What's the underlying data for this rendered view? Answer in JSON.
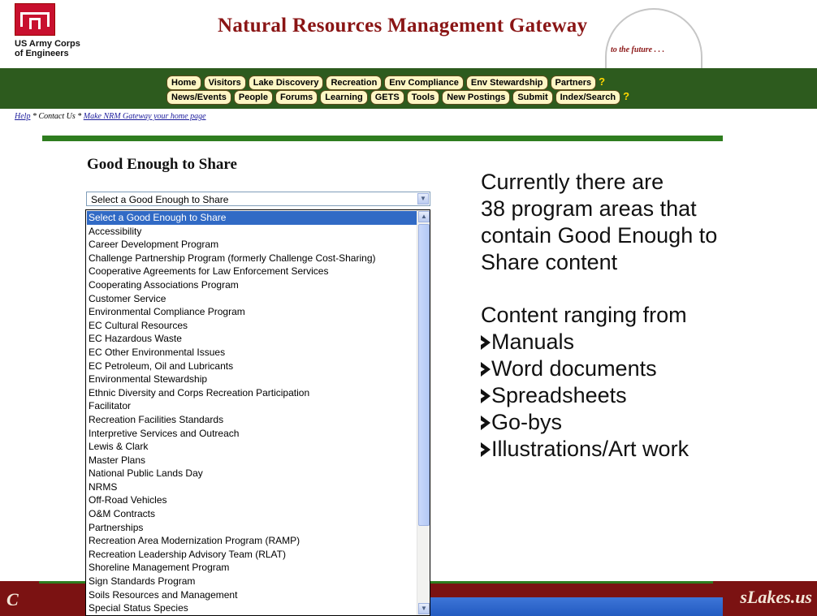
{
  "header": {
    "org_line1": "US Army Corps",
    "org_line2": "of Engineers",
    "title": "Natural Resources Management Gateway",
    "tagline": "to the future . . ."
  },
  "nav": {
    "row1": [
      "Home",
      "Visitors",
      "Lake Discovery",
      "Recreation",
      "Env Compliance",
      "Env Stewardship",
      "Partners"
    ],
    "row2": [
      "News/Events",
      "People",
      "Forums",
      "Learning",
      "GETS",
      "Tools",
      "New Postings",
      "Submit",
      "Index/Search"
    ],
    "help_icon": "?"
  },
  "help_links": {
    "help": "Help",
    "sep1": " * Contact Us * ",
    "homepage": "Make NRM Gateway your home page"
  },
  "section": {
    "heading": "Good Enough to Share"
  },
  "select": {
    "value": "Select a Good Enough to Share",
    "options": [
      "Select a Good Enough to Share",
      "Accessibility",
      "Career Development Program",
      "Challenge Partnership Program (formerly Challenge Cost-Sharing)",
      "Cooperative Agreements for Law Enforcement Services",
      "Cooperating Associations Program",
      "Customer Service",
      "Environmental Compliance Program",
      "EC Cultural Resources",
      "EC Hazardous Waste",
      "EC Other Environmental Issues",
      "EC Petroleum, Oil and Lubricants",
      "Environmental Stewardship",
      "Ethnic Diversity and Corps Recreation Participation",
      "Facilitator",
      "Recreation Facilities Standards",
      "Interpretive Services and Outreach",
      "Lewis & Clark",
      "Master Plans",
      "National Public Lands Day",
      "NRMS",
      "Off-Road Vehicles",
      "O&M Contracts",
      "Partnerships",
      "Recreation Area Modernization Program (RAMP)",
      "Recreation Leadership Advisory Team (RLAT)",
      "Shoreline Management Program",
      "Sign Standards Program",
      "Soils Resources and Management",
      "Special Status Species"
    ]
  },
  "info": {
    "lines": [
      "Currently there are",
      "38 program areas that",
      "contain Good Enough to",
      "Share content"
    ],
    "range_intro": "Content ranging from",
    "bullets": [
      "Manuals",
      "Word documents",
      "Spreadsheets",
      "Go-bys",
      "Illustrations/Art work"
    ]
  },
  "footer": {
    "left_text": "C",
    "right_text": "sLakes.us"
  },
  "colors": {
    "nav_band": "#2d5b1e",
    "title": "#8a1515",
    "selected_option": "#316ac5",
    "bottom_bar": "#7b1212"
  }
}
